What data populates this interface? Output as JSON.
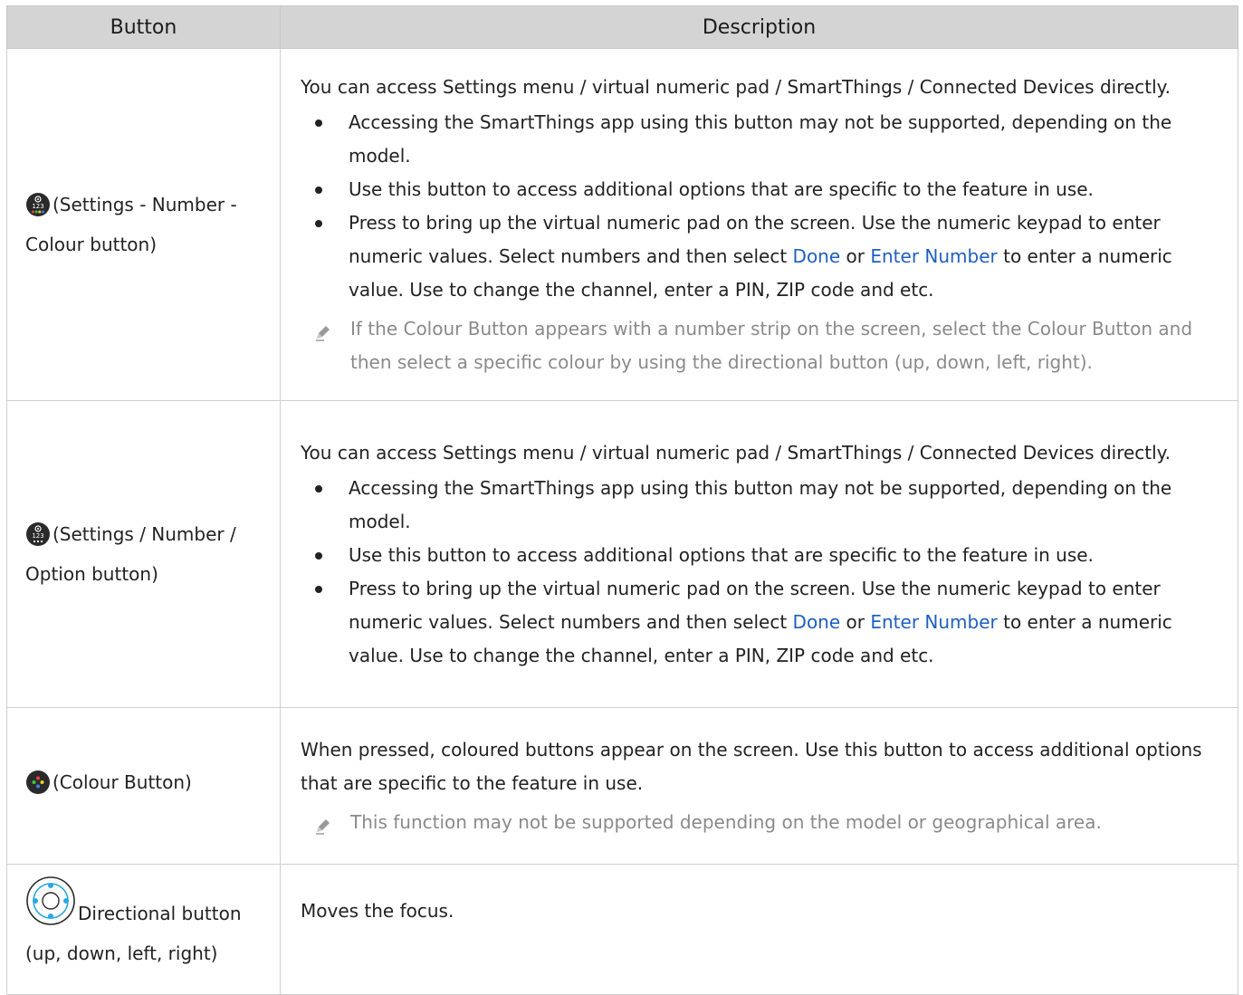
{
  "table": {
    "headers": [
      "Button",
      "Description"
    ],
    "rows": [
      {
        "icon": "settings-number-colour-icon",
        "button_label": "(Settings - Number - Colour button)",
        "intro": "You can access Settings menu / virtual numeric pad / SmartThings / Connected Devices directly.",
        "bullets": [
          "Accessing the SmartThings app using this button may not be supported, depending on the model.",
          "Use this button to access additional options that are specific to the feature in use."
        ],
        "bullet3": {
          "a": "Press to bring up the virtual numeric pad on the screen. Use the numeric keypad to enter numeric values. Select numbers and then select ",
          "link1": "Done",
          "b": " or ",
          "link2": "Enter Number",
          "c": " to enter a numeric value. Use to change the channel, enter a PIN, ZIP code and etc."
        },
        "note": "If the Colour Button appears with a number strip on the screen, select the Colour Button and then select a specific colour by using the directional button (up, down, left, right)."
      },
      {
        "icon": "settings-number-option-icon",
        "button_label": "(Settings / Number / Option button)",
        "intro": "You can access Settings menu / virtual numeric pad / SmartThings / Connected Devices directly.",
        "bullets": [
          "Accessing the SmartThings app using this button may not be supported, depending on the model.",
          "Use this button to access additional options that are specific to the feature in use."
        ],
        "bullet3": {
          "a": "Press to bring up the virtual numeric pad on the screen. Use the numeric keypad to enter numeric values. Select numbers and then select ",
          "link1": "Done",
          "b": " or ",
          "link2": "Enter Number",
          "c": " to enter a numeric value. Use to change the channel, enter a PIN, ZIP code and etc."
        }
      },
      {
        "icon": "colour-button-icon",
        "button_label": "(Colour Button)",
        "intro": "When pressed, coloured buttons appear on the screen. Use this button to access additional options that are specific to the feature in use.",
        "note": "This function may not be supported depending on the model or geographical area."
      },
      {
        "icon": "directional-button-icon",
        "button_label": "Directional button (up, down, left, right)",
        "intro": "Moves the focus."
      }
    ]
  },
  "colors": {
    "header_bg": "#d4d4d4",
    "link": "#1f5fbf",
    "note_text": "#8a8a8a",
    "directional_accent": "#29a8e0"
  }
}
